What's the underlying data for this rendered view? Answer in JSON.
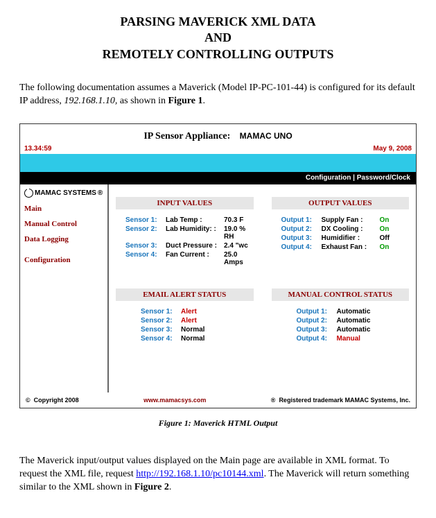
{
  "doc": {
    "title_line1": "PARSING MAVERICK XML DATA",
    "title_line2": "AND",
    "title_line3": "REMOTELY CONTROLLING OUTPUTS",
    "intro_part1": "The following documentation assumes a Maverick (Model IP-PC-101-44) is configured for its default IP address, ",
    "intro_ip": "192.168.1.10,",
    "intro_part2": " as shown in ",
    "intro_figref": "Figure 1",
    "intro_part3": ".",
    "caption1": "Figure 1: Maverick HTML Output",
    "para2_part1": "The Maverick input/output values displayed on the Main page are available in XML format. To request the XML file, request ",
    "para2_link": "http://192.168.1.10/pc10144.xml",
    "para2_part2": ".   The Maverick will return something similar to the XML shown in ",
    "para2_figref": "Figure 2",
    "para2_part3": "."
  },
  "panel": {
    "title_prefix": "IP Sensor Appliance:",
    "title_name": "MAMAC UNO",
    "time": "13.34:59",
    "date": "May 9, 2008",
    "blackbar": "Configuration | Password/Clock",
    "logo_text": "MAMAC SYSTEMS",
    "logo_tm": "®",
    "sidebar": {
      "items": [
        {
          "label": "Main"
        },
        {
          "label": "Manual Control"
        },
        {
          "label": "Data Logging"
        },
        {
          "label": "Configuration"
        }
      ]
    },
    "sections": {
      "input_values": {
        "header": "INPUT VALUES",
        "rows": [
          {
            "key": "Sensor 1:",
            "name": "Lab Temp :",
            "value": "70.3 F"
          },
          {
            "key": "Sensor 2:",
            "name": "Lab Humidity: :",
            "value": "19.0 % RH"
          },
          {
            "key": "Sensor 3:",
            "name": "Duct Pressure :",
            "value": "2.4 \"wc"
          },
          {
            "key": "Sensor 4:",
            "name": "Fan Current :",
            "value": "25.0 Amps"
          }
        ]
      },
      "output_values": {
        "header": "OUTPUT VALUES",
        "rows": [
          {
            "key": "Output 1:",
            "name": "Supply Fan :",
            "value": "On",
            "cls": "val-on"
          },
          {
            "key": "Output 2:",
            "name": "DX Cooling :",
            "value": "On",
            "cls": "val-on"
          },
          {
            "key": "Output 3:",
            "name": "Humidifier :",
            "value": "Off",
            "cls": "val-off"
          },
          {
            "key": "Output 4:",
            "name": "Exhaust Fan :",
            "value": "On",
            "cls": "val-on"
          }
        ]
      },
      "email_alert": {
        "header": "EMAIL ALERT STATUS",
        "rows": [
          {
            "key": "Sensor 1:",
            "value": "Alert",
            "cls": "val-alert"
          },
          {
            "key": "Sensor 2:",
            "value": "Alert",
            "cls": "val-alert"
          },
          {
            "key": "Sensor 3:",
            "value": "Normal",
            "cls": ""
          },
          {
            "key": "Sensor 4:",
            "value": "Normal",
            "cls": ""
          }
        ]
      },
      "manual_control": {
        "header": "MANUAL CONTROL STATUS",
        "rows": [
          {
            "key": "Output 1:",
            "value": "Automatic",
            "cls": ""
          },
          {
            "key": "Output 2:",
            "value": "Automatic",
            "cls": ""
          },
          {
            "key": "Output 3:",
            "value": "Automatic",
            "cls": ""
          },
          {
            "key": "Output 4:",
            "value": "Manual",
            "cls": "val-manual"
          }
        ]
      }
    },
    "footer": {
      "left_symbol": "©",
      "left": "Copyright 2008",
      "center": "www.mamacsys.com",
      "right_symbol": "®",
      "right": "Registered trademark MAMAC Systems, Inc."
    }
  }
}
